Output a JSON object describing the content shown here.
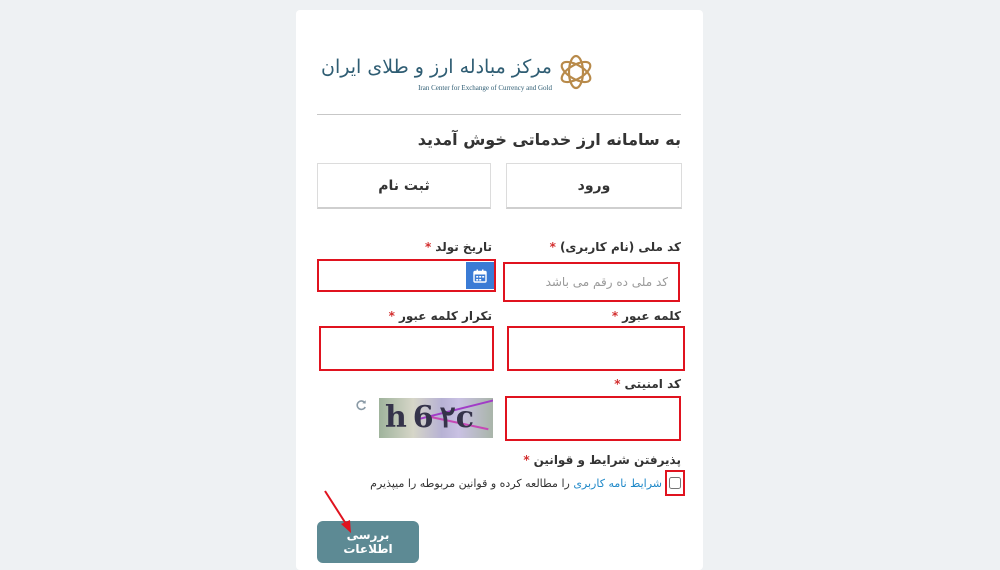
{
  "logo": {
    "name_fa": "مرکز مبادله ارز و طلای ایران",
    "name_en": "Iran Center for Exchange of Currency and Gold"
  },
  "welcome": "به سامانه ارز خدماتی خوش آمدید",
  "tabs": [
    {
      "label": "ورود"
    },
    {
      "label": "ثبت نام"
    }
  ],
  "form": {
    "national_code": {
      "label": "کد ملی (نام کاربری)",
      "placeholder": "کد ملی ده رقم می باشد",
      "value": ""
    },
    "birth_date": {
      "label": "تاریخ تولد",
      "value": ""
    },
    "password": {
      "label": "کلمه عبور",
      "value": ""
    },
    "password_repeat": {
      "label": "تکرار کلمه عبور",
      "value": ""
    },
    "security_code": {
      "label": "کد امنیتی",
      "value": ""
    },
    "captcha_text": "h6٢c",
    "accept_terms": {
      "label": "پذیرفتن شرایط و قوانین",
      "text_link": "شرایط نامه کاربری",
      "text_rest": "را مطالعه کرده و قوانین مربوطه را میپذیرم"
    },
    "required_mark": "*"
  },
  "submit_label": "بررسی اطلاعات",
  "icons": {
    "calendar": "calendar-icon",
    "refresh": "refresh-icon",
    "logo_mark": "logo-knot-icon",
    "annotation": "red-arrow-icon"
  },
  "colors": {
    "highlight_border": "#e0131f",
    "submit_bg": "#5d8a94",
    "calendar_btn": "#3a7bd5",
    "link": "#1e88c8"
  }
}
